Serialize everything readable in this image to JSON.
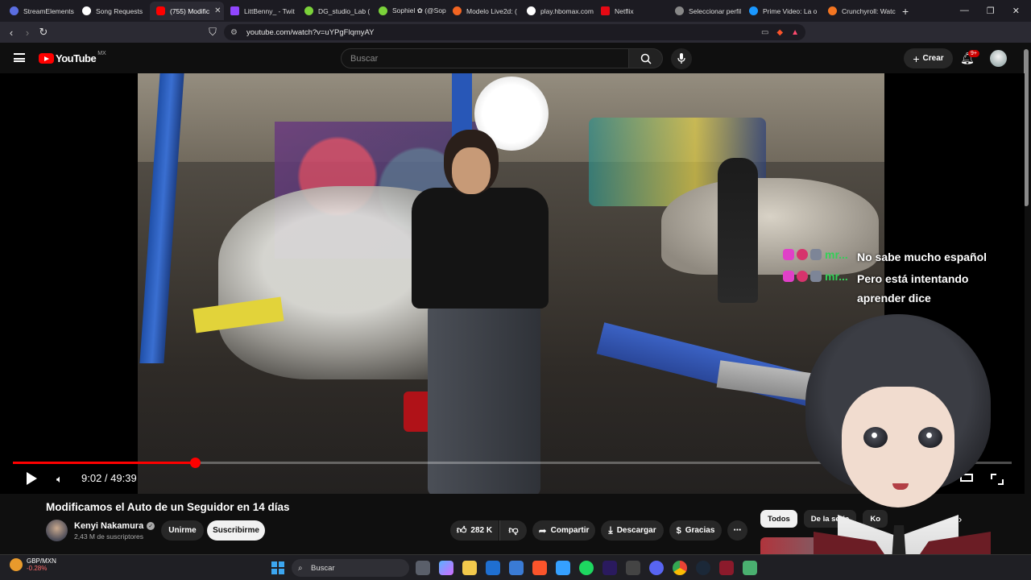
{
  "browser": {
    "tabs": [
      {
        "label": "StreamElements",
        "color": "#5b6ee1"
      },
      {
        "label": "Song Requests",
        "color": "#ffffff"
      },
      {
        "label": "(755) Modific",
        "color": "#ff0000",
        "active": true
      },
      {
        "label": "LittBenny_ - Twit",
        "color": "#9146ff"
      },
      {
        "label": "DG_studio_Lab (",
        "color": "#7bd23a"
      },
      {
        "label": "Sophiel ✿ (@Sop",
        "color": "#7bd23a"
      },
      {
        "label": "Modelo Live2d: (",
        "color": "#f26522"
      },
      {
        "label": "play.hbomax.com",
        "color": "#ffffff"
      },
      {
        "label": "Netflix",
        "color": "#e50914"
      },
      {
        "label": "Seleccionar perfil",
        "color": "#888888"
      },
      {
        "label": "Prime Video: La o",
        "color": "#1a98ff"
      },
      {
        "label": "Crunchyroll: Watc",
        "color": "#f47521"
      }
    ],
    "url": "youtube.com/watch?v=uYPgFlqmyAY"
  },
  "youtube": {
    "logo_text": "YouTube",
    "region": "MX",
    "search_placeholder": "Buscar",
    "create_label": "Crear",
    "notif_badge": "9+"
  },
  "player": {
    "time_current": "9:02",
    "time_total": "49:39",
    "time_display": "9:02 / 49:39",
    "progress_fraction": 0.182
  },
  "chat": [
    {
      "user": "mr...",
      "message": "No sabe mucho español"
    },
    {
      "user": "mr...",
      "message": "Pero está intentando aprender dice"
    }
  ],
  "video": {
    "title": "Modificamos el Auto de un Seguidor en 14 días",
    "channel": "Kenyi Nakamura",
    "subscribers": "2,43 M de suscriptores",
    "join_label": "Unirme",
    "subscribe_label": "Suscribirme",
    "likes": "282 K",
    "share_label": "Compartir",
    "download_label": "Descargar",
    "thanks_label": "Gracias"
  },
  "chips": [
    {
      "label": "Todos",
      "selected": true
    },
    {
      "label": "De la serie",
      "selected": false
    },
    {
      "label": "Ko",
      "selected": false
    }
  ],
  "taskbar": {
    "widget_pair": "GBP/MXN",
    "widget_change": "-0.28%",
    "search_label": "Buscar"
  },
  "colors": {
    "accent": "#ff0000",
    "chat_user": "#34d058"
  }
}
